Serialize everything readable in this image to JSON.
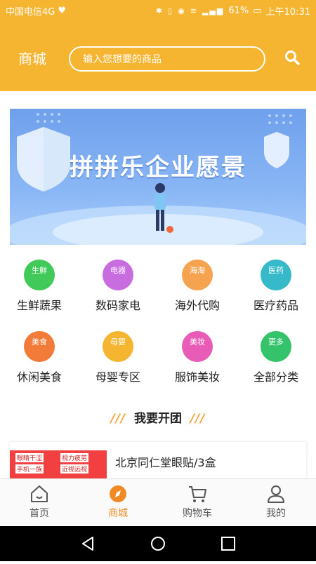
{
  "status_bar": {
    "carrier": "中国电信4G",
    "battery": "61%",
    "time": "上午10:31"
  },
  "header": {
    "title": "商城",
    "search_placeholder": "输入您想要的商品"
  },
  "banner": {
    "text": "拼拼乐企业愿景"
  },
  "categories": [
    {
      "tag": "生鲜",
      "label": "生鲜蔬果",
      "color": "#41c95a"
    },
    {
      "tag": "电器",
      "label": "数码家电",
      "color": "#c86de0"
    },
    {
      "tag": "海淘",
      "label": "海外代购",
      "color": "#f6a350"
    },
    {
      "tag": "医药",
      "label": "医疗药品",
      "color": "#36b9c9"
    },
    {
      "tag": "美食",
      "label": "休闲美食",
      "color": "#f27b3a"
    },
    {
      "tag": "母婴",
      "label": "母婴专区",
      "color": "#f6b531"
    },
    {
      "tag": "美妆",
      "label": "服饰美妆",
      "color": "#e85bb7"
    },
    {
      "tag": "更多",
      "label": "全部分类",
      "color": "#34c36b"
    }
  ],
  "section": {
    "title": "我要开团",
    "slashes": "///"
  },
  "product": {
    "name": "北京同仁堂眼贴/3盒",
    "thumb_lines": [
      "眼睛干涩",
      "视力疲劳",
      "手机一族",
      "近视远视"
    ]
  },
  "tabs": [
    {
      "label": "首页",
      "icon": "home-icon"
    },
    {
      "label": "商城",
      "icon": "compass-icon"
    },
    {
      "label": "购物车",
      "icon": "cart-icon"
    },
    {
      "label": "我的",
      "icon": "user-icon"
    }
  ],
  "colors": {
    "brand": "#f6b531",
    "active_tab": "#f08a24"
  }
}
